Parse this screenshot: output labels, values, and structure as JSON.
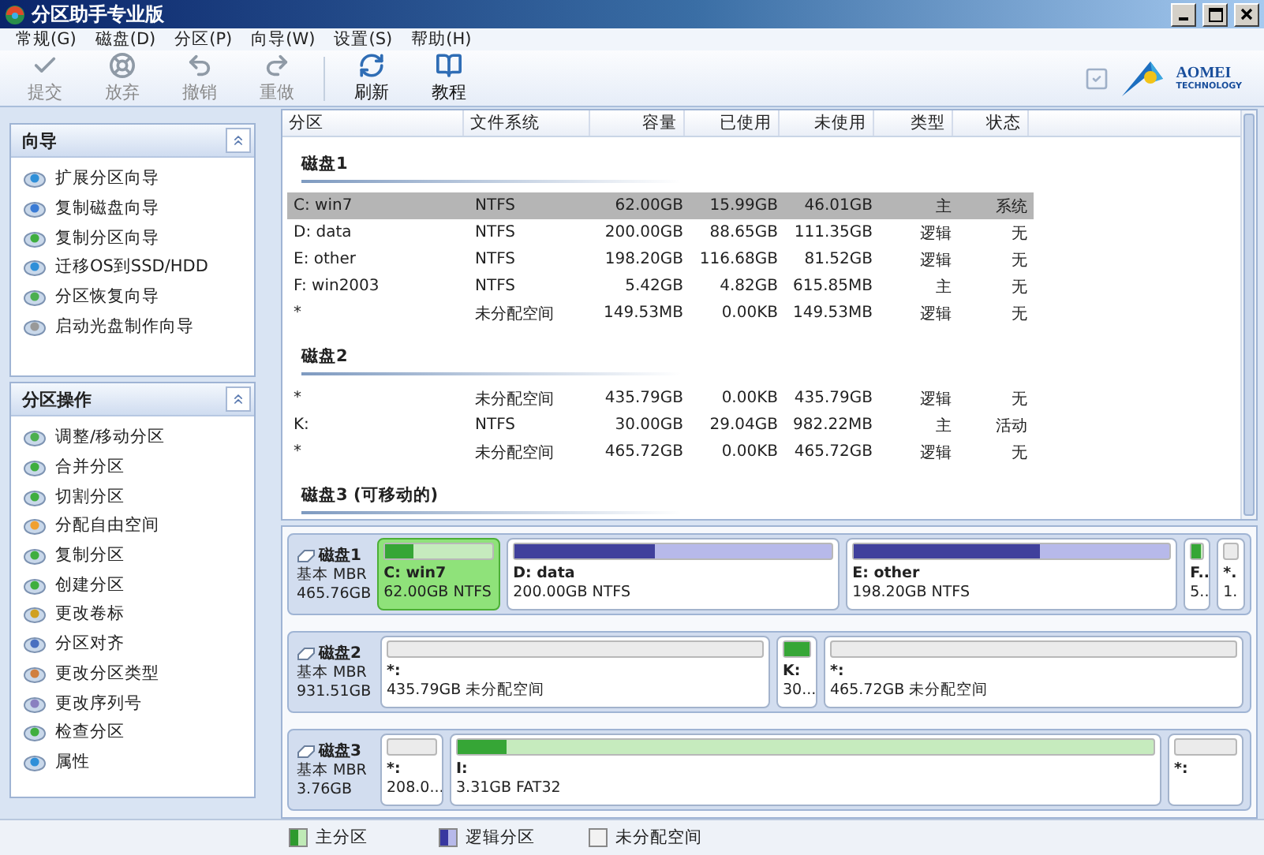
{
  "window": {
    "title": "分区助手专业版"
  },
  "menu": [
    {
      "label": "常规(G)"
    },
    {
      "label": "磁盘(D)"
    },
    {
      "label": "分区(P)"
    },
    {
      "label": "向导(W)"
    },
    {
      "label": "设置(S)"
    },
    {
      "label": "帮助(H)"
    }
  ],
  "toolbar": [
    {
      "kind": "commit",
      "label": "提交",
      "disabled": true
    },
    {
      "kind": "discard",
      "label": "放弃",
      "disabled": true
    },
    {
      "kind": "undo",
      "label": "撤销",
      "disabled": true
    },
    {
      "kind": "redo",
      "label": "重做",
      "disabled": true
    },
    {
      "kind": "refresh",
      "label": "刷新",
      "disabled": false
    },
    {
      "kind": "tutorial",
      "label": "教程",
      "disabled": false
    }
  ],
  "logo": {
    "name": "AOMEI",
    "tagline": "TECHNOLOGY"
  },
  "sidebar": {
    "panels": [
      {
        "title": "向导",
        "expanded": true,
        "items": [
          {
            "label": "扩展分区向导"
          },
          {
            "label": "复制磁盘向导"
          },
          {
            "label": "复制分区向导"
          },
          {
            "label": "迁移OS到SSD/HDD"
          },
          {
            "label": "分区恢复向导"
          },
          {
            "label": "启动光盘制作向导"
          }
        ]
      },
      {
        "title": "分区操作",
        "expanded": true,
        "items": [
          {
            "label": "调整/移动分区"
          },
          {
            "label": "合并分区"
          },
          {
            "label": "切割分区"
          },
          {
            "label": "分配自由空间"
          },
          {
            "label": "复制分区"
          },
          {
            "label": "创建分区"
          },
          {
            "label": "更改卷标"
          },
          {
            "label": "分区对齐"
          },
          {
            "label": "更改分区类型"
          },
          {
            "label": "更改序列号"
          },
          {
            "label": "检查分区"
          },
          {
            "label": "属性"
          }
        ]
      }
    ]
  },
  "table": {
    "columns": [
      "分区",
      "文件系统",
      "容量",
      "已使用",
      "未使用",
      "类型",
      "状态"
    ],
    "groups": [
      {
        "title": "磁盘1",
        "rows": [
          {
            "selected": true,
            "cells": [
              "C: win7",
              "NTFS",
              "62.00GB",
              "15.99GB",
              "46.01GB",
              "主",
              "系统"
            ]
          },
          {
            "selected": false,
            "cells": [
              "D: data",
              "NTFS",
              "200.00GB",
              "88.65GB",
              "111.35GB",
              "逻辑",
              "无"
            ]
          },
          {
            "selected": false,
            "cells": [
              "E: other",
              "NTFS",
              "198.20GB",
              "116.68GB",
              "81.52GB",
              "逻辑",
              "无"
            ]
          },
          {
            "selected": false,
            "cells": [
              "F: win2003",
              "NTFS",
              "5.42GB",
              "4.82GB",
              "615.85MB",
              "主",
              "无"
            ]
          },
          {
            "selected": false,
            "cells": [
              "*",
              "未分配空间",
              "149.53MB",
              "0.00KB",
              "149.53MB",
              "逻辑",
              "无"
            ]
          }
        ]
      },
      {
        "title": "磁盘2",
        "rows": [
          {
            "selected": false,
            "cells": [
              "*",
              "未分配空间",
              "435.79GB",
              "0.00KB",
              "435.79GB",
              "逻辑",
              "无"
            ]
          },
          {
            "selected": false,
            "cells": [
              "K:",
              "NTFS",
              "30.00GB",
              "29.04GB",
              "982.22MB",
              "主",
              "活动"
            ]
          },
          {
            "selected": false,
            "cells": [
              "*",
              "未分配空间",
              "465.72GB",
              "0.00KB",
              "465.72GB",
              "逻辑",
              "无"
            ]
          }
        ]
      },
      {
        "title": "磁盘3 (可移动的)"
      }
    ]
  },
  "disk_map": {
    "disks": [
      {
        "name": "磁盘1",
        "type": "基本 MBR",
        "size": "465.76GB",
        "partitions": [
          {
            "kind": "primary",
            "selected": true,
            "level": 0.26,
            "name": "C: win7",
            "detail": "62.00GB NTFS"
          },
          {
            "kind": "logical",
            "selected": false,
            "level": 0.44,
            "name": "D: data",
            "detail": "200.00GB NTFS"
          },
          {
            "kind": "logical",
            "selected": false,
            "level": 0.59,
            "name": "E: other",
            "detail": "198.20GB NTFS"
          },
          {
            "kind": "primary",
            "selected": false,
            "level": 0.89,
            "name": "F..",
            "detail": "5.."
          },
          {
            "kind": "unallocated",
            "selected": false,
            "name": "*.",
            "detail": "1."
          }
        ]
      },
      {
        "name": "磁盘2",
        "type": "基本 MBR",
        "size": "931.51GB",
        "partitions": [
          {
            "kind": "unallocated",
            "selected": false,
            "name": "*:",
            "detail": "435.79GB 未分配空间"
          },
          {
            "kind": "primary",
            "selected": false,
            "level": 0.97,
            "name": "K:",
            "detail": "30..."
          },
          {
            "kind": "unallocated",
            "selected": false,
            "name": "*:",
            "detail": "465.72GB 未分配空间"
          }
        ]
      },
      {
        "name": "磁盘3",
        "type": "基本 MBR",
        "size": "3.76GB",
        "partitions": [
          {
            "kind": "unallocated",
            "selected": false,
            "name": "*:",
            "detail": "208.0..."
          },
          {
            "kind": "primary",
            "selected": false,
            "level": 0.07,
            "name": "I:",
            "detail": "3.31GB FAT32"
          },
          {
            "kind": "unallocated",
            "selected": false,
            "name": "*:"
          }
        ]
      }
    ]
  },
  "legend": [
    {
      "kind": "primary",
      "label": "主分区"
    },
    {
      "kind": "logical",
      "label": "逻辑分区"
    },
    {
      "kind": "unallocated",
      "label": "未分配空间"
    }
  ]
}
